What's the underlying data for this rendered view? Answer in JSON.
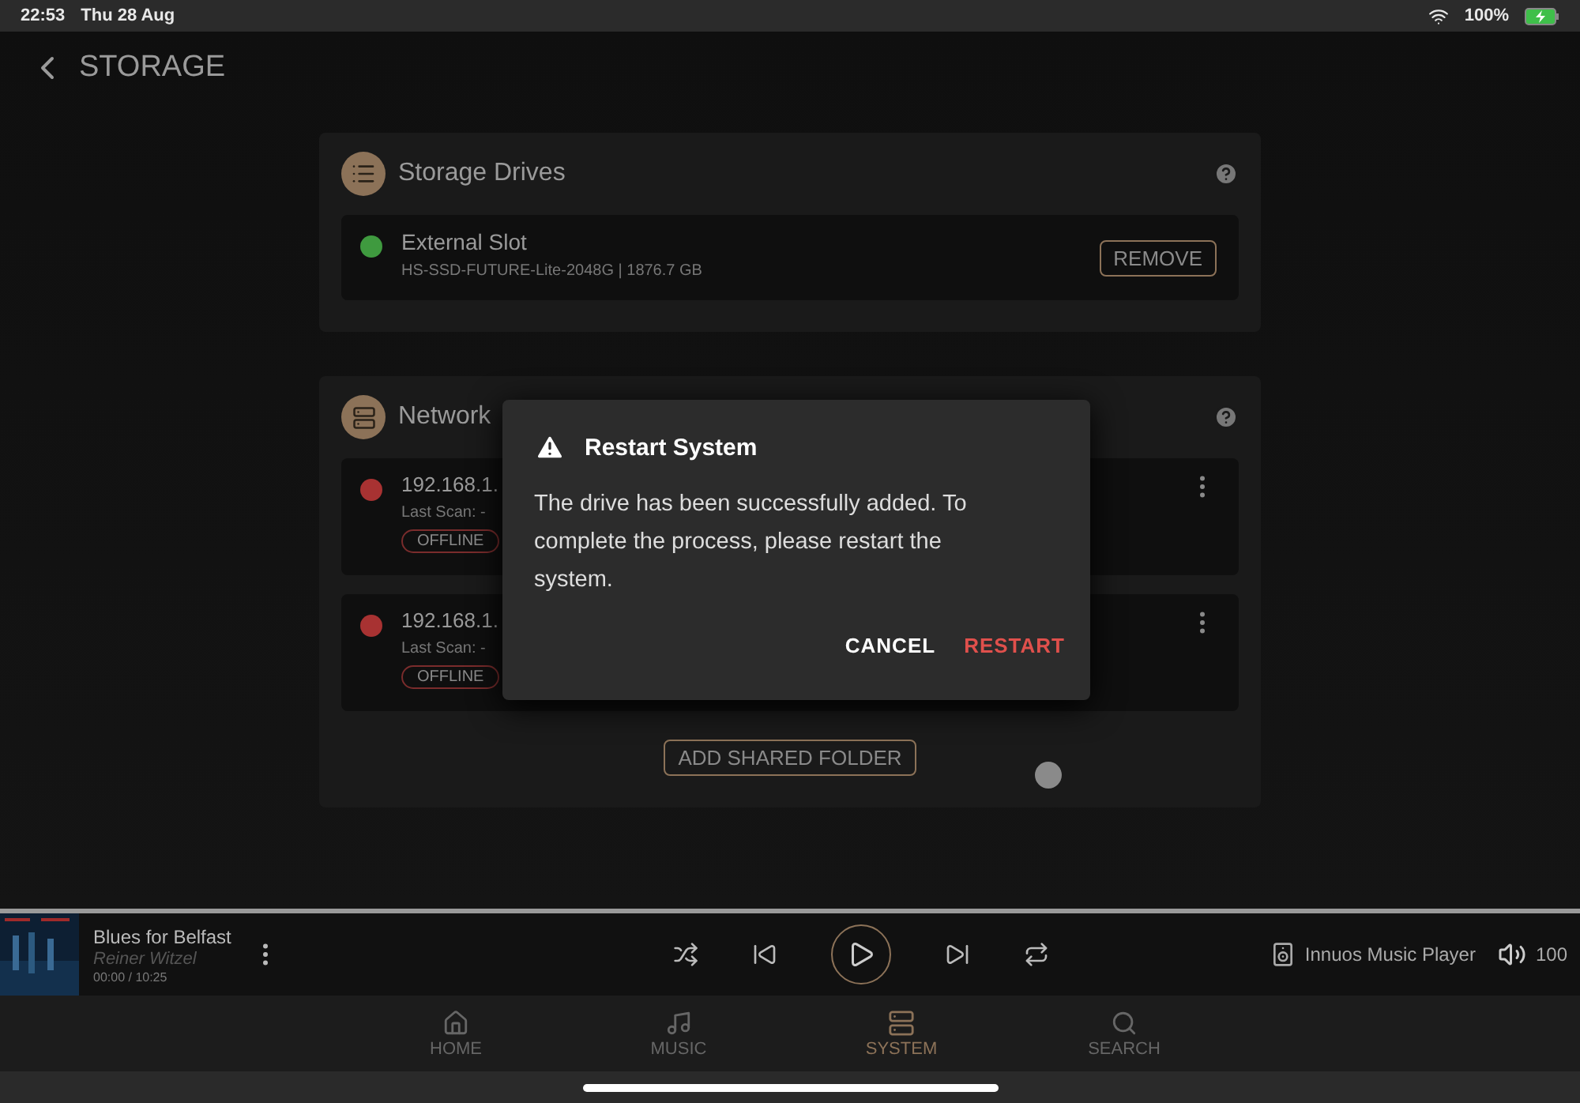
{
  "status_bar": {
    "time": "22:53",
    "date": "Thu 28 Aug",
    "battery": "100%"
  },
  "header": {
    "title": "STORAGE"
  },
  "storage_drives": {
    "title": "Storage Drives",
    "drives": [
      {
        "name": "External Slot",
        "detail": "HS-SSD-FUTURE-Lite-2048G | 1876.7 GB",
        "color": "#3f9a3f",
        "action": "REMOVE"
      }
    ]
  },
  "network": {
    "title": "Network",
    "shares": [
      {
        "address": "192.168.1.",
        "last_scan": "Last Scan: -",
        "status": "OFFLINE",
        "color": "#a83232"
      },
      {
        "address": "192.168.1.",
        "last_scan": "Last Scan: -",
        "status": "OFFLINE",
        "color": "#a83232"
      }
    ],
    "add_button": "ADD SHARED FOLDER"
  },
  "dialog": {
    "title": "Restart System",
    "message": "The drive has been successfully added. To complete the process, please restart the system.",
    "buttons": [
      {
        "label": "CANCEL",
        "kind": "neutral"
      },
      {
        "label": "RESTART",
        "kind": "danger"
      }
    ]
  },
  "player": {
    "title": "Blues for Belfast",
    "artist": "Reiner Witzel",
    "time": "00:00 / 10:25",
    "device": "Innuos Music Player",
    "volume": "100"
  },
  "nav": [
    {
      "label": "HOME",
      "kind": "home",
      "selected": false
    },
    {
      "label": "MUSIC",
      "kind": "music",
      "selected": false
    },
    {
      "label": "SYSTEM",
      "kind": "system",
      "selected": true
    },
    {
      "label": "SEARCH",
      "kind": "search",
      "selected": false
    }
  ]
}
